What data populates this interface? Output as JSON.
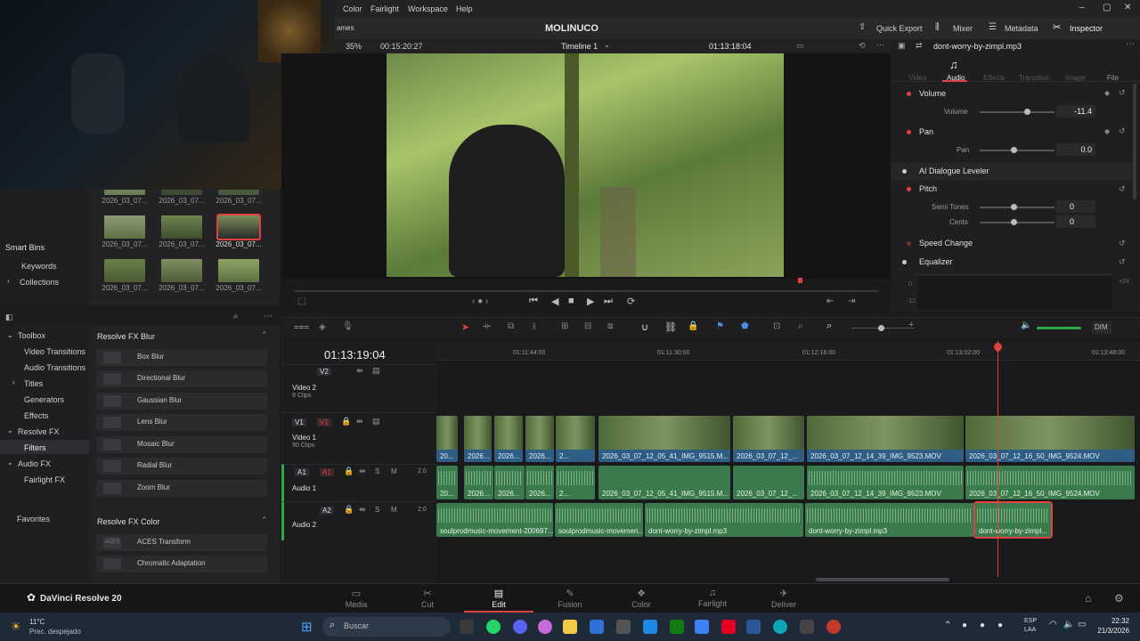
{
  "menu": {
    "items": [
      "Color",
      "Fairlight",
      "Workspace",
      "Help"
    ]
  },
  "toolbar": {
    "partial_left": "ames",
    "project_name": "MOLINUCO",
    "quick_export": "Quick Export",
    "mixer": "Mixer",
    "metadata": "Metadata",
    "inspector": "Inspector"
  },
  "viewer": {
    "zoom": "35%",
    "source_timecode": "00:15:20:27",
    "timeline_name": "Timeline 1",
    "record_timecode": "01:13:18:04"
  },
  "inspector": {
    "clip_name": "dont-worry-by-zimpl.mp3",
    "tabs": [
      "Video",
      "Audio",
      "Effects",
      "Transition",
      "Image",
      "File"
    ],
    "active_tab": "Audio",
    "volume_section": "Volume",
    "volume_label": "Volume",
    "volume_value": "-11.4",
    "pan_section": "Pan",
    "pan_label": "Pan",
    "pan_value": "0.0",
    "ai_leveler": "AI Dialogue Leveler",
    "pitch_section": "Pitch",
    "semitones_label": "Semi Tones",
    "semitones_value": "0",
    "cents_label": "Cents",
    "cents_value": "0",
    "speed_change": "Speed Change",
    "equalizer": "Equalizer",
    "eq_scale": [
      "+24",
      "0",
      "-12"
    ]
  },
  "mediapool": {
    "captions": [
      "2026_03_07...",
      "2026_03_07...",
      "2026_03_07...",
      "2026_03_07...",
      "2026_03_07...",
      "2026_03_07...",
      "2026_03_07...",
      "2026_03_07...",
      "2026_03_07..."
    ]
  },
  "left_sidebar": {
    "smart_bins": "Smart Bins",
    "keywords": "Keywords",
    "collections": "Collections"
  },
  "fx_sidebar": {
    "toolbox": "Toolbox",
    "video_transitions": "Video Transitions",
    "audio_transitions": "Audio Transitions",
    "titles": "Titles",
    "generators": "Generators",
    "effects": "Effects",
    "resolve_fx": "Resolve FX",
    "filters": "Filters",
    "audio_fx": "Audio FX",
    "fairlight_fx": "Fairlight FX",
    "favorites": "Favorites"
  },
  "fx_list": {
    "section1": "Resolve FX Blur",
    "items1": [
      "Box Blur",
      "Directional Blur",
      "Gaussian Blur",
      "Lens Blur",
      "Mosaic Blur",
      "Radial Blur",
      "Zoom Blur"
    ],
    "section2": "Resolve FX Color",
    "items2": [
      "ACES Transform",
      "Chromatic Adaptation"
    ],
    "item_icon_text": "ACES"
  },
  "timeline": {
    "timecode": "01:13:19:04",
    "ruler": [
      "01:11:44:00",
      "01:11:30:00",
      "01:12:16:00",
      "01:13:02:00",
      "01:13:48:00"
    ],
    "tracks": [
      {
        "id": "V2",
        "name": "Video 2",
        "clips": "9 Clips"
      },
      {
        "id": "V1",
        "name": "Video 1",
        "clips": "90 Clips"
      },
      {
        "id": "A1",
        "name": "Audio 1",
        "level": "2.0"
      },
      {
        "id": "A2",
        "name": "Audio 2",
        "level": "2.0"
      }
    ],
    "v1_labels": [
      "20...",
      "2026...",
      "2026...",
      "2...",
      "2026_03_07_12_05_41_IMG_9515.M...",
      "2026_03_07_12_...",
      "2026_03_07_12_14_39_IMG_9523.MOV",
      "2026_03_07_12_16_50_IMG_9524.MOV"
    ],
    "a1_labels": [
      "20...",
      "2026...",
      "2026...",
      "2...",
      "2026_03_07_12_05_41_IMG_9515.M...",
      "2026_03_07_12_...",
      "2026_03_07_12_14_39_IMG_9523.MOV",
      "2026_03_07_12_16_50_IMG_9524.MOV"
    ],
    "a2_labels": [
      "soulprodmusic-movement-200697...",
      "soulprodmusic-movemen...",
      "dont-worry-by-zimpl.mp3",
      "dont-worry-by-zimpl.mp3",
      "dont-worry-by-zimpl..."
    ],
    "dim": "DIM"
  },
  "pages": {
    "app_name": "DaVinci Resolve 20",
    "items": [
      "Media",
      "Cut",
      "Edit",
      "Fusion",
      "Color",
      "Fairlight",
      "Deliver"
    ],
    "active": "Edit"
  },
  "taskbar": {
    "temp": "11°C",
    "weather": "Prec. despejado",
    "search": "Buscar",
    "lang1": "ESP",
    "lang2": "LAA",
    "time": "22:32",
    "date": "21/3/2026"
  },
  "colors": {
    "accent": "#e0403f",
    "video_clip": "#2e5d86",
    "audio_clip": "#3b7a4c"
  }
}
